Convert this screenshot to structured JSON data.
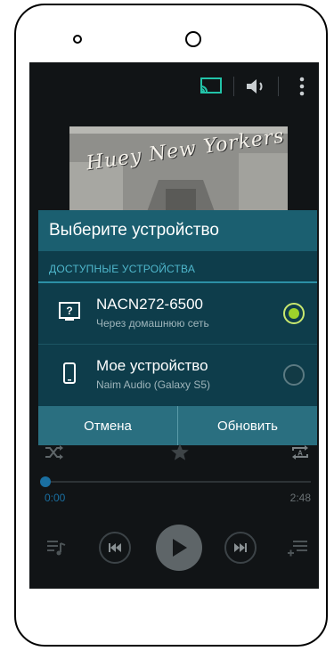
{
  "dialog": {
    "title": "Выберите устройство",
    "section_label": "ДОСТУПНЫЕ УСТРОЙСТВА",
    "devices": [
      {
        "name": "NACN272-6500",
        "subtitle": "Через домашнюю сеть",
        "icon": "unknown-device-icon",
        "selected": true
      },
      {
        "name": "Мое устройство",
        "subtitle": "Naim Audio (Galaxy S5)",
        "icon": "phone-icon",
        "selected": false
      }
    ],
    "cancel_label": "Отмена",
    "refresh_label": "Обновить"
  },
  "player": {
    "elapsed": "0:00",
    "duration": "2:48",
    "progress": 0.0
  },
  "colors": {
    "accent": "#1a6fa1",
    "dialog_header": "#1b5f70",
    "dialog_body": "#0e3d4b",
    "section_text": "#4fb7cc",
    "selected_radio": "#9ed22b",
    "cast_icon": "#22c3a8"
  }
}
